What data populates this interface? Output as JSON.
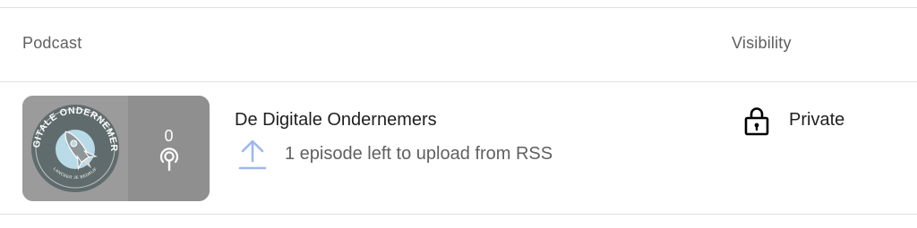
{
  "table": {
    "headers": {
      "podcast": "Podcast",
      "visibility": "Visibility"
    },
    "rows": [
      {
        "title": "De Digitale Ondernemers",
        "artwork_text": "DIGITALE ONDERNEMERS",
        "artwork_tagline": "LANCEER JE BEDRIJF",
        "episode_count": "0",
        "upload_status": "1 episode left to upload from RSS",
        "visibility": "Private",
        "icons": {
          "episodes": "microphone-icon",
          "upload": "upload-arrow-icon",
          "visibility": "lock-icon"
        }
      }
    ]
  },
  "colors": {
    "upload_icon": "#9db7f2",
    "thumb_bg": "#9b9b9b",
    "thumb_side_bg": "#8f8f8f",
    "artwork_circle": "#5f6b6c",
    "artwork_planet": "#b9dbe7"
  }
}
